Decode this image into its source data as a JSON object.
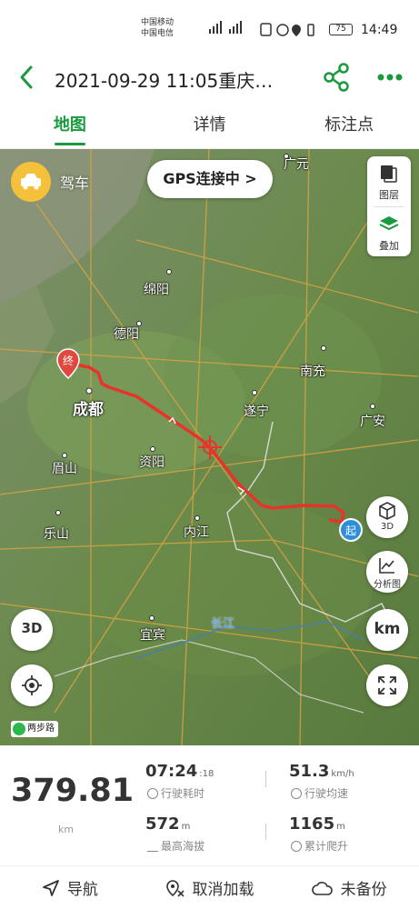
{
  "status_bar": {
    "carrier_1": "中国移动",
    "carrier_2": "中国电信",
    "battery": "75",
    "time": "14:49"
  },
  "header": {
    "title": "2021-09-29 11:05重庆…"
  },
  "tabs": [
    {
      "label": "地图",
      "active": true
    },
    {
      "label": "详情",
      "active": false
    },
    {
      "label": "标注点",
      "active": false
    }
  ],
  "map": {
    "mode_label": "驾车",
    "gps_label": "GPS连接中 >",
    "layer_buttons": {
      "layers": "图层",
      "overlay": "叠加"
    },
    "right_buttons": {
      "three_d": "3D",
      "analysis": "分析图",
      "unit": "km"
    },
    "left_buttons": {
      "three_d": "3D"
    },
    "start_marker": "起",
    "end_marker": "终",
    "logo_text": "两步路",
    "cities": {
      "guangyuan": "广元",
      "mianyang": "绵阳",
      "deyang": "德阳",
      "nanchong": "南充",
      "chengdu": "成都",
      "suining": "遂宁",
      "guangan": "广安",
      "meishan": "眉山",
      "ziyang": "资阳",
      "leshan": "乐山",
      "neijiang": "内江",
      "yibin": "宜宾",
      "changjiang": "长江"
    },
    "colors": {
      "route": "#e8332a",
      "start": "#2f8fd8",
      "end": "#e0473e"
    }
  },
  "stats": {
    "distance": "379.81",
    "distance_unit": "km",
    "duration": "07:24",
    "duration_seconds": ":18",
    "duration_label": "行驶耗时",
    "avg_speed": "51.3",
    "avg_speed_unit": "km/h",
    "avg_speed_label": "行驶均速",
    "max_altitude": "572",
    "max_altitude_unit": "m",
    "max_altitude_label": "最高海拔",
    "climb": "1165",
    "climb_unit": "m",
    "climb_label": "累计爬升"
  },
  "bottom_bar": {
    "navigate": "导航",
    "cancel_load": "取消加载",
    "not_backed_up": "未备份"
  },
  "accent_color": "#1a9a3e"
}
